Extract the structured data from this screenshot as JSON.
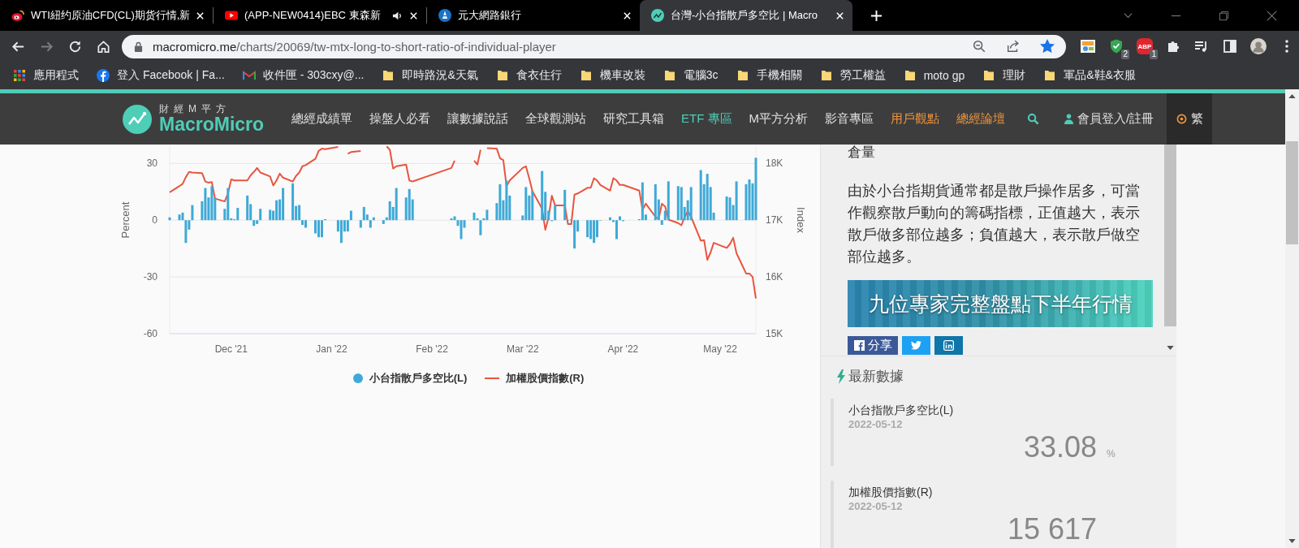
{
  "browser": {
    "tabs": [
      {
        "title": "WTI紐约原油CFD(CL)期货行情,新",
        "selected": false,
        "audio": false
      },
      {
        "title": "(APP-NEW0414)EBC 東森新",
        "selected": false,
        "audio": true
      },
      {
        "title": "元大網路銀行",
        "selected": false,
        "audio": false
      },
      {
        "title": "台灣-小台指散戶多空比 | Macro",
        "selected": true,
        "audio": false
      }
    ],
    "forward_disabled": true,
    "url_host": "macromicro.me",
    "url_path": "/charts/20069/tw-mtx-long-to-short-ratio-of-individual-player",
    "bookmarked": true,
    "extension_badges": [
      "2",
      "1"
    ],
    "abp_label": "ABP",
    "bookmarks": [
      {
        "label": "應用程式",
        "kind": "apps"
      },
      {
        "label": "登入 Facebook | Fa...",
        "kind": "facebook"
      },
      {
        "label": "收件匣 - 303cxy@...",
        "kind": "mail"
      },
      {
        "label": "即時路況&天氣",
        "kind": "folder"
      },
      {
        "label": "食衣住行",
        "kind": "folder"
      },
      {
        "label": "機車改裝",
        "kind": "folder"
      },
      {
        "label": "電腦3c",
        "kind": "folder"
      },
      {
        "label": "手機相關",
        "kind": "folder"
      },
      {
        "label": "勞工權益",
        "kind": "folder"
      },
      {
        "label": "moto gp",
        "kind": "folder"
      },
      {
        "label": "理財",
        "kind": "folder"
      },
      {
        "label": "軍品&鞋&衣服",
        "kind": "folder"
      }
    ]
  },
  "site_nav": {
    "tagline": "財經M平方",
    "brand": "MacroMicro",
    "items": [
      {
        "label": "總經成績單",
        "color": "#e0e0e0"
      },
      {
        "label": "操盤人必看",
        "color": "#e0e0e0"
      },
      {
        "label": "讓數據說話",
        "color": "#e0e0e0"
      },
      {
        "label": "全球觀測站",
        "color": "#e0e0e0"
      },
      {
        "label": "研究工具箱",
        "color": "#e0e0e0"
      },
      {
        "label": "ETF 專區",
        "color": "#4ecdb7"
      },
      {
        "label": "M平方分析",
        "color": "#e0e0e0"
      },
      {
        "label": "影音專區",
        "color": "#e0e0e0"
      },
      {
        "label": "用戶觀點",
        "color": "#f0953f"
      },
      {
        "label": "總經論壇",
        "color": "#f0953f"
      }
    ],
    "login": "會員登入/註冊",
    "language": "繁",
    "language_selected": true
  },
  "chart": {
    "chart_data": {
      "type": "bar",
      "ylabel": "Percent",
      "y2label": "Index",
      "xlim": [
        "2021-11-12",
        "2022-05-12"
      ],
      "ylim": [
        -60,
        40
      ],
      "y2lim": [
        15000,
        18333
      ],
      "grid": true,
      "yticks": [
        -60,
        -30,
        0,
        30
      ],
      "y2ticks": [
        {
          "value": 15000,
          "label": "15K"
        },
        {
          "value": 16000,
          "label": "16K"
        },
        {
          "value": 17000,
          "label": "17K"
        },
        {
          "value": 18000,
          "label": "18K"
        }
      ],
      "xticks": [
        {
          "value": "2021-12-01",
          "label": "Dec '21"
        },
        {
          "value": "2022-01-01",
          "label": "Jan '22"
        },
        {
          "value": "2022-02-01",
          "label": "Feb '22"
        },
        {
          "value": "2022-03-01",
          "label": "Mar '22"
        },
        {
          "value": "2022-04-01",
          "label": "Apr '22"
        },
        {
          "value": "2022-05-01",
          "label": "May '22"
        }
      ],
      "x": [
        "2021-11-12",
        "2021-11-15",
        "2021-11-16",
        "2021-11-17",
        "2021-11-18",
        "2021-11-19",
        "2021-11-22",
        "2021-11-23",
        "2021-11-24",
        "2021-11-25",
        "2021-11-26",
        "2021-11-29",
        "2021-11-30",
        "2021-12-01",
        "2021-12-02",
        "2021-12-03",
        "2021-12-06",
        "2021-12-07",
        "2021-12-08",
        "2021-12-09",
        "2021-12-10",
        "2021-12-13",
        "2021-12-14",
        "2021-12-15",
        "2021-12-16",
        "2021-12-17",
        "2021-12-20",
        "2021-12-21",
        "2021-12-22",
        "2021-12-23",
        "2021-12-24",
        "2021-12-27",
        "2021-12-28",
        "2021-12-29",
        "2021-12-30",
        "2022-01-03",
        "2022-01-04",
        "2022-01-05",
        "2022-01-06",
        "2022-01-07",
        "2022-01-10",
        "2022-01-11",
        "2022-01-12",
        "2022-01-13",
        "2022-01-14",
        "2022-01-17",
        "2022-01-18",
        "2022-01-19",
        "2022-01-20",
        "2022-01-21",
        "2022-01-24",
        "2022-01-25",
        "2022-01-26",
        "2022-02-07",
        "2022-02-08",
        "2022-02-09",
        "2022-02-10",
        "2022-02-11",
        "2022-02-14",
        "2022-02-15",
        "2022-02-16",
        "2022-02-17",
        "2022-02-18",
        "2022-02-21",
        "2022-02-22",
        "2022-02-23",
        "2022-02-24",
        "2022-02-25",
        "2022-03-01",
        "2022-03-02",
        "2022-03-03",
        "2022-03-04",
        "2022-03-07",
        "2022-03-08",
        "2022-03-09",
        "2022-03-10",
        "2022-03-11",
        "2022-03-14",
        "2022-03-15",
        "2022-03-16",
        "2022-03-17",
        "2022-03-18",
        "2022-03-21",
        "2022-03-22",
        "2022-03-23",
        "2022-03-24",
        "2022-03-25",
        "2022-03-28",
        "2022-03-29",
        "2022-03-30",
        "2022-03-31",
        "2022-04-01",
        "2022-04-06",
        "2022-04-07",
        "2022-04-08",
        "2022-04-11",
        "2022-04-12",
        "2022-04-13",
        "2022-04-14",
        "2022-04-15",
        "2022-04-18",
        "2022-04-19",
        "2022-04-20",
        "2022-04-21",
        "2022-04-22",
        "2022-04-25",
        "2022-04-26",
        "2022-04-27",
        "2022-04-28",
        "2022-04-29",
        "2022-05-03",
        "2022-05-04",
        "2022-05-05",
        "2022-05-06",
        "2022-05-09",
        "2022-05-10",
        "2022-05-11",
        "2022-05-12"
      ],
      "series": [
        {
          "name": "小台指散戶多空比(L)",
          "color": "#3ea9d8",
          "values": [
            1.5,
            3,
            4,
            -12,
            -5,
            8,
            10,
            17,
            12,
            18,
            12,
            6,
            17,
            1,
            0.5,
            6.5,
            13,
            8.5,
            -3,
            -2,
            6,
            5.5,
            5,
            10.5,
            11,
            17,
            19.5,
            7.5,
            8,
            -2.5,
            -4,
            -7,
            -9,
            -9,
            0.5,
            -6,
            -12,
            -6,
            -6,
            5,
            -4,
            7,
            3,
            -4,
            1.5,
            -2,
            1.5,
            10,
            7,
            17,
            12,
            16.5,
            11,
            1,
            2,
            -3,
            -10,
            -4,
            4,
            1,
            -8,
            1,
            5.5,
            9,
            19,
            10.5,
            21,
            13,
            2.5,
            17.5,
            13,
            15.5,
            26,
            15,
            5,
            -0.5,
            8,
            16,
            0,
            0.5,
            -15,
            -6,
            -9,
            -10,
            -12,
            -9,
            0,
            1.5,
            -1,
            -10,
            2,
            -0.5,
            0.5,
            20,
            3,
            19,
            11,
            -2.5,
            5,
            20.5,
            18,
            17.5,
            7,
            10.5,
            17.5,
            26.5,
            19,
            24.5,
            17.5,
            4,
            12.5,
            12,
            8,
            20.5,
            19,
            21.5,
            19.5,
            33
          ]
        },
        {
          "name": "加權股價指數(R)",
          "type": "line",
          "axis": "y2",
          "color": "#e8553e",
          "values": [
            17490,
            17600,
            17640,
            17760,
            17850,
            17840,
            17830,
            17680,
            17660,
            17670,
            17380,
            17330,
            17470,
            17720,
            17700,
            17700,
            17700,
            17790,
            17850,
            17920,
            17840,
            17770,
            17610,
            17700,
            17820,
            17750,
            17680,
            17780,
            17840,
            17950,
            17970,
            18080,
            18220,
            18260,
            18250,
            18290,
            null,
            null,
            18170,
            18200,
            18220,
            null,
            null,
            null,
            null,
            null,
            18300,
            18240,
            17910,
            17950,
            17980,
            17700,
            17680,
            17920,
            18050,
            null,
            null,
            null,
            18050,
            17980,
            18240,
            null,
            18270,
            18260,
            18090,
            18060,
            17600,
            17700,
            17920,
            17950,
            17740,
            17510,
            17200,
            16830,
            17050,
            17430,
            17260,
            17260,
            16930,
            16930,
            17450,
            17470,
            17570,
            17570,
            17740,
            17700,
            17620,
            17520,
            17740,
            17700,
            17620,
            17620,
            17520,
            17180,
            17290,
            17060,
            17020,
            17290,
            17240,
            17010,
            16950,
            16910,
            17050,
            17160,
            17060,
            16640,
            16650,
            16300,
            16430,
            16600,
            16510,
            16580,
            16690,
            16420,
            16060,
            16060,
            16000,
            15620
          ]
        }
      ]
    }
  },
  "sidebar": {
    "heading_fragment": "倉量",
    "description": "由於小台指期貨通常都是散戶操作居多，可當作觀察散戶動向的籌碼指標，正值越大，表示散戶做多部位越多；負值越大，表示散戶做空部位越多。",
    "banner_text": "九位專家完整盤點下半年行情",
    "share_label": "分享",
    "latest_title": "最新數據",
    "latest": [
      {
        "name": "小台指散戶多空比(L)",
        "date": "2022-05-12",
        "value": "33.08",
        "unit": "%"
      },
      {
        "name": "加權股價指數(R)",
        "date": "2022-05-12",
        "value": "15 617"
      }
    ]
  }
}
